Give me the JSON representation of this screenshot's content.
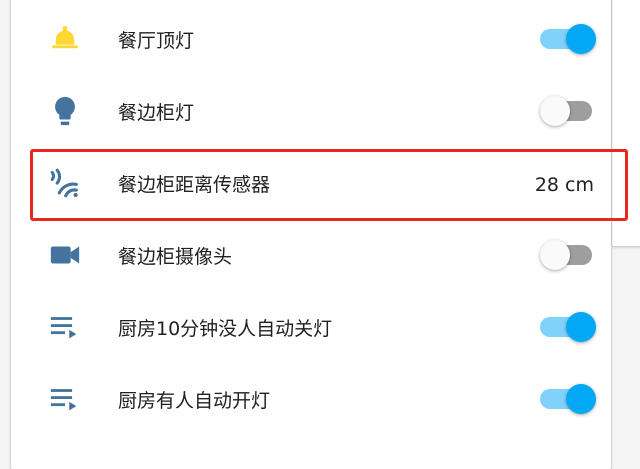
{
  "entities": [
    {
      "name": "餐厅顶灯",
      "icon": "ceiling-light-icon",
      "icon_color": "#fdd835",
      "control": "toggle",
      "state": "on"
    },
    {
      "name": "餐边柜灯",
      "icon": "lightbulb-icon",
      "icon_color": "#44739e",
      "control": "toggle",
      "state": "off"
    },
    {
      "name": "餐边柜距离传感器",
      "icon": "signal-distance-icon",
      "icon_color": "#44739e",
      "control": "value",
      "value": "28 cm"
    },
    {
      "name": "餐边柜摄像头",
      "icon": "video-camera-icon",
      "icon_color": "#44739e",
      "control": "toggle",
      "state": "off"
    },
    {
      "name": "厨房10分钟没人自动关灯",
      "icon": "playlist-play-icon",
      "icon_color": "#44739e",
      "control": "toggle",
      "state": "on"
    },
    {
      "name": "厨房有人自动开灯",
      "icon": "playlist-play-icon",
      "icon_color": "#44739e",
      "control": "toggle",
      "state": "on"
    }
  ],
  "colors": {
    "toggle_on_knob": "#03a9f4",
    "toggle_on_track": "#80d2fb",
    "toggle_off_knob": "#fafafa",
    "toggle_off_track": "#9e9e9e",
    "highlight_border": "#e8281c",
    "text": "#212121"
  }
}
